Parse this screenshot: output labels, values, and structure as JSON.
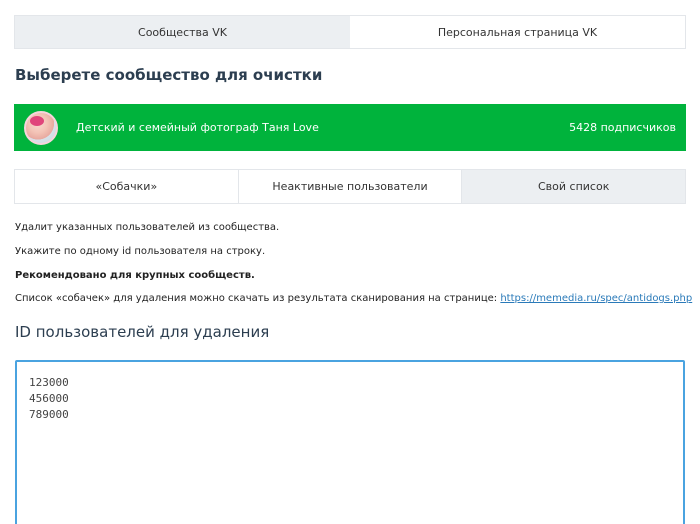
{
  "top_tabs": [
    {
      "label": "Сообщества VK",
      "active": true
    },
    {
      "label": "Персональная страница VK",
      "active": false
    }
  ],
  "section_title": "Выберете сообщество для очистки",
  "community": {
    "name": "Детский и семейный фотограф Таня Love",
    "subscribers": "5428 подписчиков",
    "bar_color": "#00b33c",
    "avatar_icon": "avatar-photo"
  },
  "mode_tabs": [
    {
      "label": "«Собачки»",
      "active": false
    },
    {
      "label": "Неактивные пользователи",
      "active": false
    },
    {
      "label": "Свой список",
      "active": true
    }
  ],
  "info": {
    "line1": "Удалит указанных пользователей из сообщества.",
    "line2": "Укажите по одному id пользователя на строку.",
    "line3": "Рекомендовано для крупных сообществ.",
    "line4_prefix": "Список «собачек» для удаления можно скачать из результата сканирования на странице: ",
    "line4_link": "https://memedia.ru/spec/antidogs.php"
  },
  "ids_title": "ID пользователей для удаления",
  "ids_value": "123000\n456000\n789000",
  "accent_color": "#4aa3e0"
}
